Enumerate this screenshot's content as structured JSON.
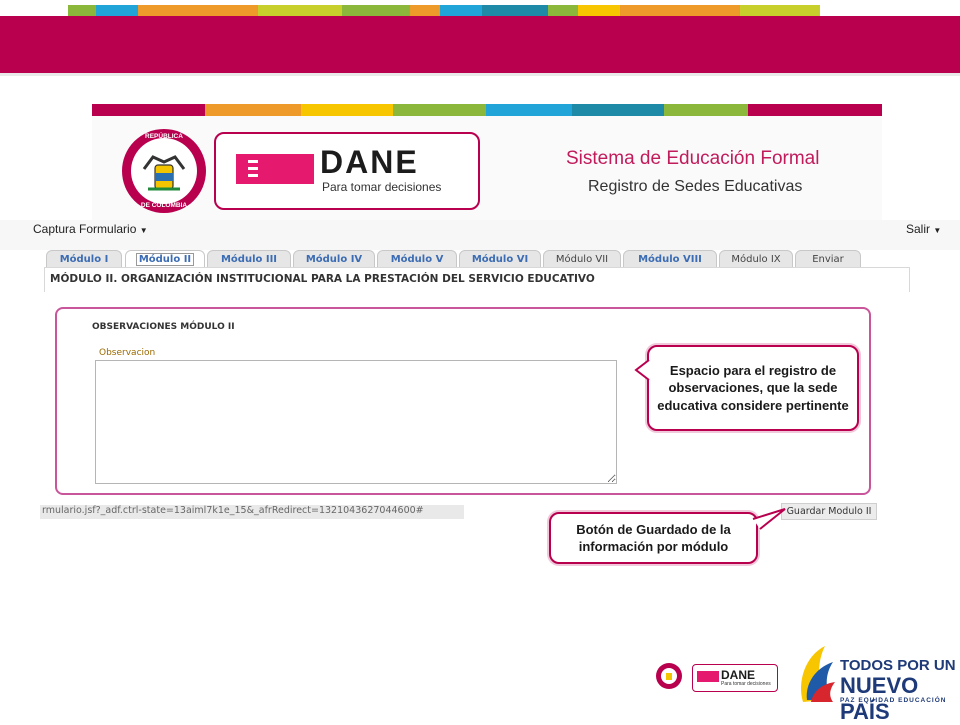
{
  "colors": {
    "crimson": "#b8004f",
    "tab_text": "#3b6cb4",
    "top_strip": [
      "#8bb83a",
      "#21a4d8",
      "#ee9a2b",
      "#c7cf2c",
      "#f7c600",
      "#8bb83a",
      "#21a4d8",
      "#ee9a2b",
      "#1e8aa7",
      "#21a4d8",
      "#ee9a2b",
      "#c7cf2c"
    ]
  },
  "header": {
    "shield_text_top": "REPÚBLICA",
    "shield_text_bottom": "DE COLOMBIA",
    "dane_word": "DANE",
    "dane_tagline": "Para tomar decisiones",
    "system_title": "Sistema de Educación Formal",
    "system_subtitle": "Registro de Sedes Educativas"
  },
  "menu": {
    "left": "Captura Formulario",
    "right": "Salir"
  },
  "tabs": [
    {
      "label": "Módulo I",
      "style": "link"
    },
    {
      "label": "Módulo II",
      "style": "active"
    },
    {
      "label": "Módulo III",
      "style": "link"
    },
    {
      "label": "Módulo IV",
      "style": "link"
    },
    {
      "label": "Módulo V",
      "style": "link"
    },
    {
      "label": "Módulo VI",
      "style": "link"
    },
    {
      "label": "Módulo VII",
      "style": "plain"
    },
    {
      "label": "Módulo VIII",
      "style": "link"
    },
    {
      "label": "Módulo IX",
      "style": "plain"
    },
    {
      "label": "Enviar",
      "style": "plain"
    }
  ],
  "module_title": "MÓDULO II. ORGANIZACIÓN INSTITUCIONAL PARA LA PRESTACIÓN DEL SERVICIO EDUCATIVO",
  "observations": {
    "section_title": "OBSERVACIONES MÓDULO II",
    "field_label": "Observacion",
    "field_value": ""
  },
  "status_url": "rmulario.jsf?_adf.ctrl-state=13aiml7k1e_15&_afrRedirect=1321043627044600#",
  "save_button": "Guardar Modulo II",
  "callouts": {
    "observation": "Espacio para el registro de observaciones, que la sede educativa considere pertinente",
    "save": "Botón de Guardado de la información por módulo"
  },
  "footer": {
    "dane_small": "DANE",
    "dane_small_tagline": "Para tomar decisiones",
    "todos_line1": "TODOS POR UN",
    "todos_line2": "NUEVO PAÍS",
    "todos_line3": "PAZ  EQUIDAD  EDUCACIÓN"
  }
}
